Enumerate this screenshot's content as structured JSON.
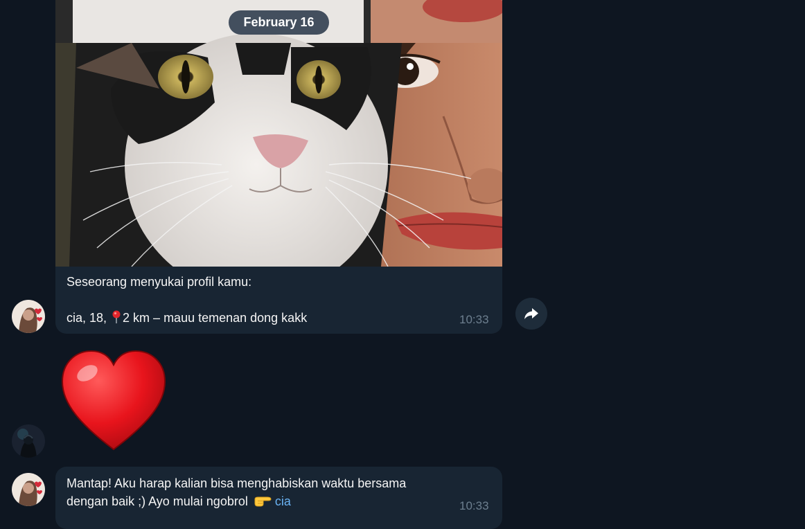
{
  "date_separator": "February 16",
  "photo_message": {
    "caption_line1": "Seseorang menyukai profil kamu:",
    "caption_line2_before_pin": "cia, 18, ",
    "caption_line2_after_pin": "2 km – mauu temenan dong kakk",
    "time": "10:33",
    "pin_icon": "round-pushpin-icon"
  },
  "forward_button": {
    "icon": "share-arrow-icon"
  },
  "heart_sticker": {
    "icon": "red-heart-icon",
    "color": "#e8141c"
  },
  "text_message": {
    "text_line1": "Mantap! Aku harap kalian bisa menghabiskan waktu bersama",
    "text_line2": "dengan baik ;) Ayo mulai ngobrol ",
    "emoji": "backhand-index-pointing-right-icon",
    "mention": "cia",
    "time": "10:33"
  },
  "colors": {
    "background": "#0e1621",
    "bubble": "#182533",
    "mention": "#6ab3f3",
    "timestamp": "#6d7f8f"
  }
}
